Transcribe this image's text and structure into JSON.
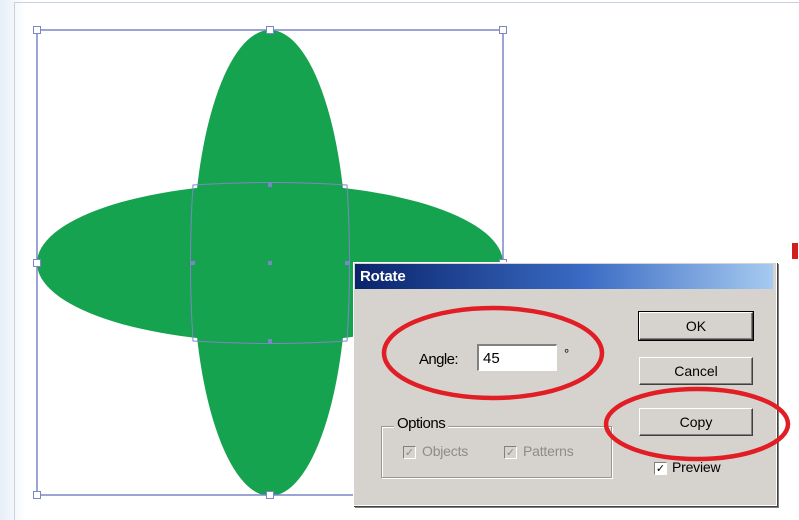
{
  "dialog": {
    "title": "Rotate",
    "angle_label": "Angle:",
    "angle_value": "45",
    "degree_symbol": "°",
    "options_legend": "Options",
    "objects_label": "Objects",
    "objects_checked": true,
    "patterns_label": "Patterns",
    "patterns_checked": true,
    "preview_label": "Preview",
    "preview_checked": true,
    "ok_label": "OK",
    "cancel_label": "Cancel",
    "copy_label": "Copy",
    "checkmark": "✓"
  },
  "colors": {
    "shape_fill": "#16a34f",
    "selection": "#7b86c6",
    "annotation": "#e11e25",
    "titlebar_start": "#0a246a",
    "titlebar_end": "#a6caf0",
    "dialog_face": "#d6d3ce"
  }
}
